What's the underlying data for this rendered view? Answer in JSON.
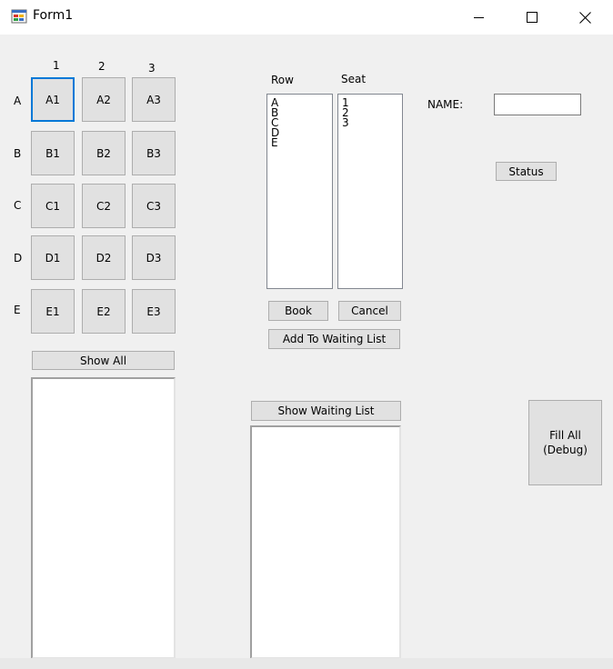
{
  "window": {
    "title": "Form1",
    "icon": "winforms-app-icon",
    "controls": {
      "minimize": "minimize-icon",
      "maximize": "maximize-icon",
      "close": "close-icon"
    }
  },
  "grid": {
    "column_labels": [
      "1",
      "2",
      "3"
    ],
    "row_labels": [
      "A",
      "B",
      "C",
      "D",
      "E"
    ],
    "seats": [
      [
        "A1",
        "A2",
        "A3"
      ],
      [
        "B1",
        "B2",
        "B3"
      ],
      [
        "C1",
        "C2",
        "C3"
      ],
      [
        "D1",
        "D2",
        "D3"
      ],
      [
        "E1",
        "E2",
        "E3"
      ]
    ],
    "focused_seat": "A1"
  },
  "show_all_button": "Show All",
  "row_list": {
    "label": "Row",
    "items": [
      "A",
      "B",
      "C",
      "D",
      "E"
    ]
  },
  "seat_list": {
    "label": "Seat",
    "items": [
      "1",
      "2",
      "3"
    ]
  },
  "book_button": "Book",
  "cancel_button": "Cancel",
  "waiting_button": "Add To Waiting List",
  "name": {
    "label": "NAME:",
    "value": ""
  },
  "status_button": "Status",
  "show_waiting_button": "Show Waiting List",
  "fill_all_button": {
    "line1": "Fill All",
    "line2": "(Debug)"
  }
}
